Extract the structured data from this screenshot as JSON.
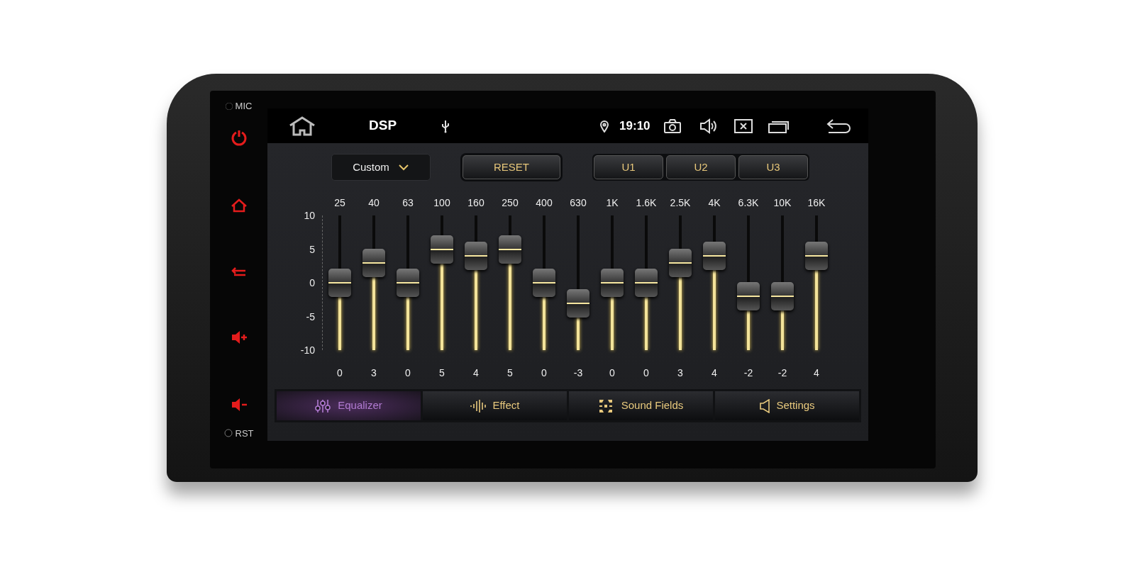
{
  "side_panel": {
    "mic_label": "MIC",
    "reset_label": "RST"
  },
  "status_bar": {
    "title": "DSP",
    "time": "19:10"
  },
  "preset": {
    "value": "Custom"
  },
  "reset_button": {
    "label": "RESET"
  },
  "user_presets": [
    {
      "label": "U1",
      "selected": false
    },
    {
      "label": "U2",
      "selected": false
    },
    {
      "label": "U3",
      "selected": false
    }
  ],
  "scale": [
    "10",
    "5",
    "0",
    "-5",
    "-10"
  ],
  "bands": [
    {
      "freq": "25",
      "value": "0",
      "level": 0.5
    },
    {
      "freq": "40",
      "value": "3",
      "level": 0.65
    },
    {
      "freq": "63",
      "value": "0",
      "level": 0.5
    },
    {
      "freq": "100",
      "value": "5",
      "level": 0.75
    },
    {
      "freq": "160",
      "value": "4",
      "level": 0.7
    },
    {
      "freq": "250",
      "value": "5",
      "level": 0.75
    },
    {
      "freq": "400",
      "value": "0",
      "level": 0.5
    },
    {
      "freq": "630",
      "value": "-3",
      "level": 0.35
    },
    {
      "freq": "1K",
      "value": "0",
      "level": 0.5
    },
    {
      "freq": "1.6K",
      "value": "0",
      "level": 0.5
    },
    {
      "freq": "2.5K",
      "value": "3",
      "level": 0.65
    },
    {
      "freq": "4K",
      "value": "4",
      "level": 0.7
    },
    {
      "freq": "6.3K",
      "value": "-2",
      "level": 0.4
    },
    {
      "freq": "10K",
      "value": "-2",
      "level": 0.4
    },
    {
      "freq": "16K",
      "value": "4",
      "level": 0.7
    }
  ],
  "tabs": [
    {
      "label": "Equalizer",
      "selected": true
    },
    {
      "label": "Effect",
      "selected": false
    },
    {
      "label": "Sound Fields",
      "selected": false
    },
    {
      "label": "Settings",
      "selected": false
    }
  ]
}
